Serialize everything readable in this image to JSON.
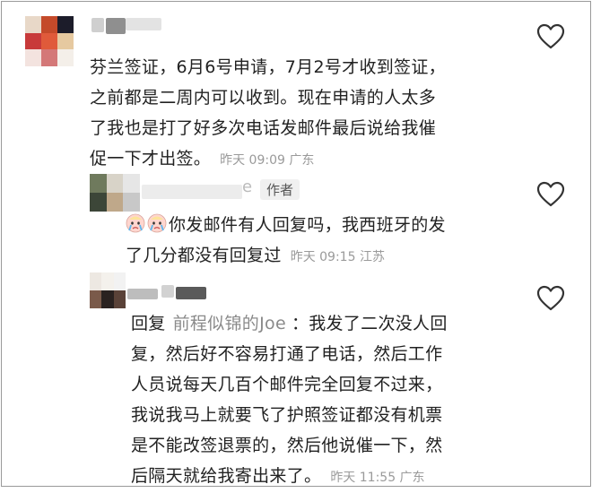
{
  "comments": [
    {
      "text_lines": [
        "芬兰签证，6月6号申请，7月2号才收到签证，",
        "之前都是二周内可以收到。现在申请的人太多",
        "了我也是打了好多次电话发邮件最后说给我催",
        "促一下才出签。"
      ],
      "meta": "昨天 09:09 广东",
      "like_icon": "heart-outline-icon"
    },
    {
      "author_tag": "作者",
      "name_fragment": "e",
      "emoji": "crying-face-emoji",
      "text_lines": [
        "你发邮件有人回复吗，我西班牙的发",
        "了几分都没有回复过"
      ],
      "meta": "昨天 09:15 江苏",
      "like_icon": "heart-outline-icon"
    },
    {
      "reply_prefix": "回复",
      "reply_target": "前程似锦的Joe",
      "text_lines": [
        "：我发了二次没人回",
        "复，然后好不容易打通了电话，然后工作",
        "人员说每天几百个邮件完全回复不过来，",
        "我说我马上就要飞了护照签证都没有机票",
        "是不能改签退票的，然后他说催一下，然",
        "后隔天就给我寄出来了。"
      ],
      "meta": "昨天 11:55 广东",
      "like_icon": "heart-outline-icon"
    }
  ]
}
